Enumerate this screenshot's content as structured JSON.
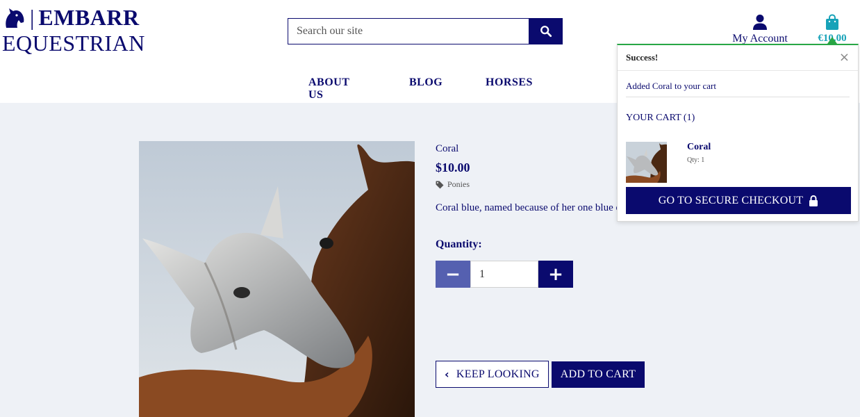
{
  "brand": {
    "name_line1": "EMBARR",
    "name_line2": "EQUESTRIAN",
    "separator": "|",
    "icon": "horse-head-icon"
  },
  "search": {
    "placeholder": "Search our site",
    "value": "",
    "icon": "search-icon"
  },
  "account": {
    "label": "My Account",
    "icon": "user-icon"
  },
  "cart": {
    "total": "€10.00",
    "icon": "shopping-bag-icon"
  },
  "nav": [
    {
      "label": "ABOUT US"
    },
    {
      "label": "BLOG"
    },
    {
      "label": "HORSES"
    }
  ],
  "product": {
    "name": "Coral",
    "price": "$10.00",
    "category": "Ponies",
    "category_icon": "tag-icon",
    "description": "Coral blue, named because of her one blue eye. A sweet pony with personality.",
    "quantity_label": "Quantity:",
    "quantity": "1",
    "keep_looking_label": "KEEP LOOKING",
    "add_to_cart_label": "ADD TO CART"
  },
  "toast": {
    "title": "Success!",
    "close_glyph": "×",
    "message": "Added Coral to your cart",
    "cart_heading": "YOUR CART (1)",
    "item_name": "Coral",
    "item_qty": "Qty: 1",
    "checkout_label": "GO TO SECURE CHECKOUT",
    "accent_color": "#28a745"
  },
  "colors": {
    "primary": "#0a0a6e",
    "accent": "#17a2b8",
    "background": "#eef1f6"
  }
}
